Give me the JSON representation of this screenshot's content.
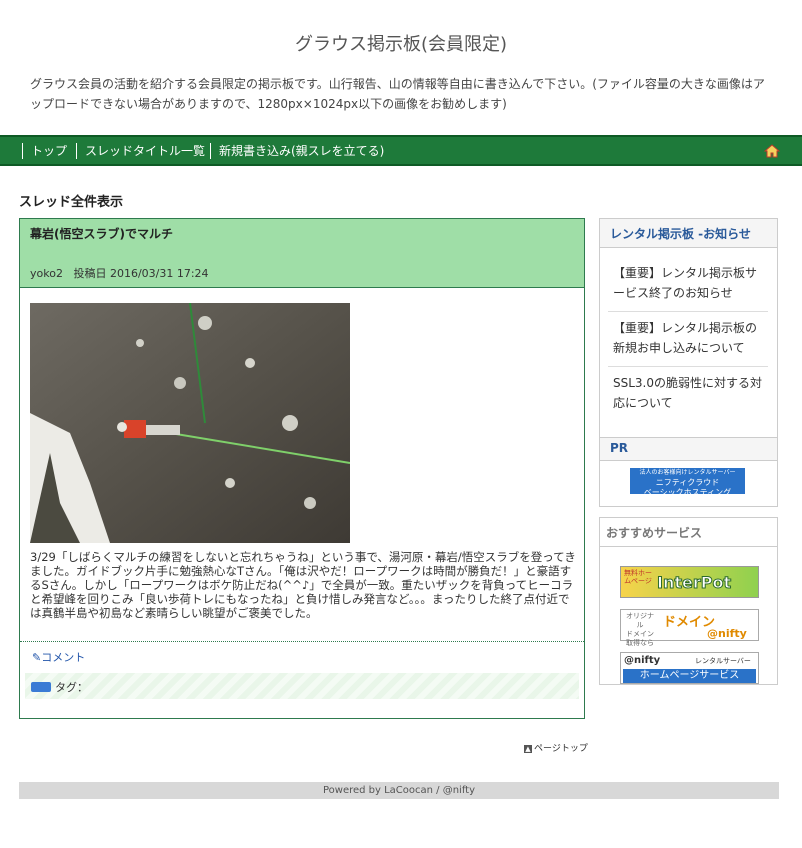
{
  "header": {
    "title": "グラウス掲示板(会員限定)",
    "description": "グラウス会員の活動を紹介する会員限定の掲示板です。山行報告、山の情報等自由に書き込んで下さい。(ファイル容量の大きな画像はアップロードできない場合がありますので、1280px×1024px以下の画像をお勧めします)"
  },
  "nav": {
    "items": [
      "トップ",
      "スレッドタイトル一覧",
      "新規書き込み(親スレを立てる)"
    ],
    "home_icon": "home-icon"
  },
  "main": {
    "section_title": "スレッド全件表示",
    "thread": {
      "title": "幕岩(悟空スラブ)でマルチ",
      "author": "yoko2",
      "date_label": "投稿日",
      "date": "2016/03/31 17:24",
      "body": "3/29「しばらくマルチの練習をしないと忘れちゃうね」という事で、湯河原・幕岩/悟空スラブを登ってきました。ガイドブック片手に勉強熱心なTさん。「俺は沢やだ！ロープワークは時間が勝負だ！」と豪語するSさん。しかし「ロープワークはボケ防止だね(^^♪」で全員が一致。重たいザックを背負ってヒーコラと希望峰を回りこみ「良い歩荷トレにもなったね」と負け惜しみ発言など。。。まったりした終了点付近では真鶴半島や初島など素晴らしい眺望がご褒美でした。",
      "comment_label": "コメント",
      "tag_label": "タグ："
    },
    "page_top": "ページトップ"
  },
  "sidebar": {
    "notice_title": "レンタル掲示板 -お知らせ",
    "notices": [
      "【重要】レンタル掲示板サービス終了のお知らせ",
      "【重要】レンタル掲示板の新規お申し込みについて",
      "SSL3.0の脆弱性に対する対応について"
    ],
    "pr_label": "PR",
    "pr_banner": [
      "法人のお客様向けレンタルサーバー",
      "ニフティクラウド",
      "ベーシックホスティング"
    ],
    "recommend_title": "おすすめサービス",
    "banners": [
      {
        "text": "InterPot",
        "sub": "無料ホームページ"
      },
      {
        "text": "ドメイン",
        "sub1": "オリジナル",
        "sub2": "ドメイン",
        "sub3": "取得なら",
        "brand": "@nifty"
      },
      {
        "text": "ホームページサービス",
        "brand": "@nifty",
        "sub": "レンタルサーバー"
      }
    ]
  },
  "footer": {
    "text": "Powered by LaCoocan / @nifty"
  },
  "colors": {
    "nav_bg": "#1e7a3a",
    "thread_head_bg": "#9fdea7",
    "thread_border": "#2e7a4e",
    "link_blue": "#2255aa"
  }
}
